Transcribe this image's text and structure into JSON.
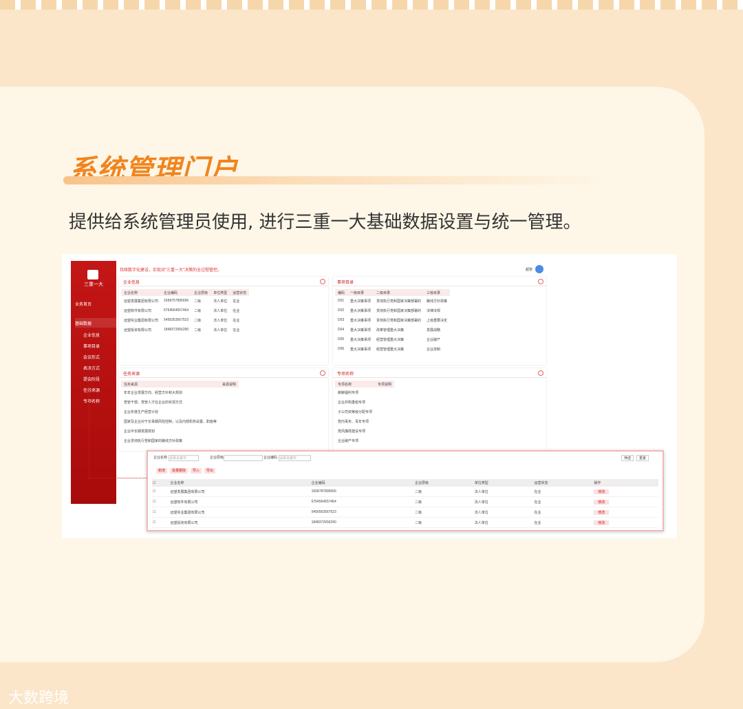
{
  "heading": {
    "title": "系统管理门户",
    "subtitle": "提供给系统管理员使用, 进行三重一大基础数据设置与统一管理。"
  },
  "screenshot": {
    "sidebar": {
      "brand": "三重一大",
      "menu": [
        "业务首页",
        "基础数据"
      ],
      "submenu": [
        "企业信息",
        "事项目录",
        "会议形式",
        "表决方式",
        "提会阶段",
        "任务来源",
        "专项名称"
      ]
    },
    "notice": "持续数字化建设，实现对“三重一大”决策的全过程管控。",
    "user": "超管",
    "company_panel": {
      "title": "企业信息",
      "headers": [
        "企业名称",
        "企业编码",
        "企业层级",
        "单位类型",
        "运营状态"
      ],
      "rows": [
        [
          "远望发展集团有限公司",
          "1658757895656",
          "二级",
          "法人单位",
          "在业"
        ],
        [
          "远望软件有限公司",
          "6764564557464",
          "二级",
          "法人单位",
          "在业"
        ],
        [
          "远望实业集团有限公司",
          "5456353567523",
          "二级",
          "法人单位",
          "在业"
        ],
        [
          "远望投资有限公司",
          "1848372656290",
          "二级",
          "法人单位",
          "在业"
        ]
      ]
    },
    "catalog_panel": {
      "title": "事项目录",
      "headers": [
        "编码",
        "一级目录",
        "二级目录",
        "三级目录"
      ],
      "rows": [
        [
          "D01",
          "重大决策事项",
          "贯彻执行党和国家决策部署的",
          "路线方针政策"
        ],
        [
          "D02",
          "重大决策事项",
          "贯彻执行党和国家决策部署的",
          "法律法规"
        ],
        [
          "D03",
          "重大决策事项",
          "贯彻执行党和国家决策部署的",
          "上级重要决定"
        ],
        [
          "D04",
          "重大决策事项",
          "改革管理重大决策",
          "发展战略"
        ],
        [
          "D05",
          "重大决策事项",
          "经营管理重大决策",
          "企业破产"
        ],
        [
          "D06",
          "重大决策事项",
          "经营管理重大决策",
          "企业改制"
        ]
      ]
    },
    "source_panel": {
      "title": "任务来源",
      "headers": [
        "任务来源",
        "来源说明"
      ],
      "items": [
        "年年企业发展方向、经营方针和大规划",
        "党管干部、党管人才在企业的实现方式",
        "企业年度生产经营计划",
        "国家及企业对于长事期风险控制，以及内部机构设置、职能等",
        "企业中长期发展规划",
        "企业贯彻执行党和国家的路线方针政策"
      ]
    },
    "special_panel": {
      "title": "专项名称",
      "headers": [
        "专项名称",
        "专项说明"
      ],
      "items": [
        "薪酬福利专项",
        "企业并购重组专项",
        "子公司资等级分配专项",
        "党内事务、青年专项",
        "党风廉政建设专项",
        "企业破产专项"
      ]
    },
    "modal": {
      "filters": [
        "企业名称",
        "企业层级",
        "企业编码"
      ],
      "placeholder": "请录关键字",
      "buttons": [
        "新增",
        "批量删除",
        "导入",
        "导出"
      ],
      "query": "筛选",
      "reset": "重置",
      "headers": [
        "企业名称",
        "企业编码",
        "企业层级",
        "单位类型",
        "运营状态",
        "操作"
      ],
      "rows": [
        [
          "远望发展集团有限公司",
          "1658787895656",
          "二级",
          "法人单位",
          "在业"
        ],
        [
          "远望软件有限公司",
          "6764564557464",
          "二级",
          "法人单位",
          "在业"
        ],
        [
          "远望实业集团有限公司",
          "5456563567523",
          "二级",
          "法人单位",
          "在业"
        ],
        [
          "远望投资有限公司",
          "1848372656290",
          "二级",
          "法人单位",
          "在业"
        ]
      ],
      "edit_label": "修改"
    }
  },
  "watermark": "大数跨境"
}
